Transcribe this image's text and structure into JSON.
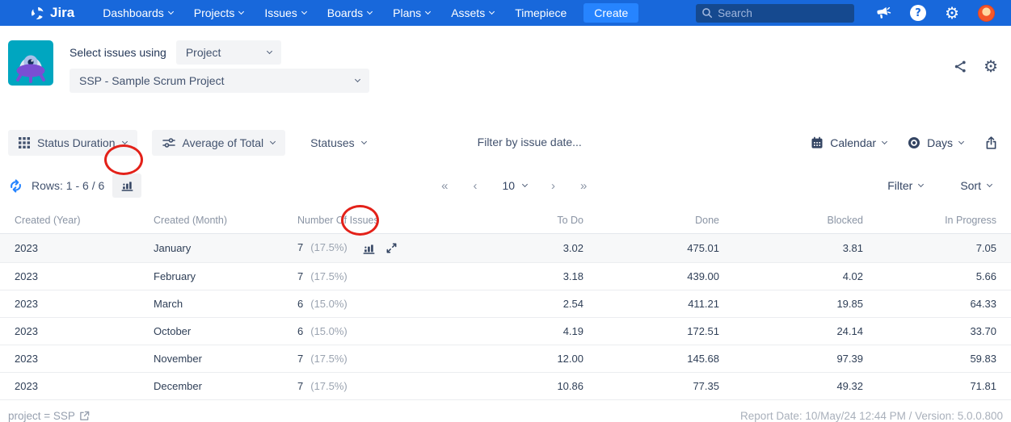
{
  "colors": {
    "nav_bg": "#1868db",
    "create_bg": "#2684ff",
    "search_bg": "#15498f",
    "accent_blue": "#2684ff",
    "annotation_red": "#e32119",
    "app_icon_teal": "#00a6c0",
    "app_icon_purple": "#7a4fd3",
    "row_highlight": "#f7f8f9"
  },
  "icons": {
    "gear_glyph": "⚙",
    "help_glyph": "?"
  },
  "nav": {
    "brand": "Jira",
    "items": [
      {
        "label": "Dashboards"
      },
      {
        "label": "Projects"
      },
      {
        "label": "Issues"
      },
      {
        "label": "Boards"
      },
      {
        "label": "Plans"
      },
      {
        "label": "Assets"
      },
      {
        "label": "Timepiece"
      }
    ],
    "create_label": "Create",
    "search_placeholder": "Search"
  },
  "header": {
    "select_label": "Select issues using",
    "issue_source": "Project",
    "project": "SSP - Sample Scrum Project"
  },
  "toolbar": {
    "report_type": "Status Duration",
    "aggregation": "Average of Total",
    "statuses_label": "Statuses",
    "date_filter_placeholder": "Filter by issue date...",
    "calendar_label": "Calendar",
    "unit_label": "Days"
  },
  "rows_bar": {
    "rows_label": "Rows: 1 - 6 / 6",
    "first": "«",
    "prev": "‹",
    "page_size": "10",
    "next": "›",
    "last": "»",
    "filter_label": "Filter",
    "sort_label": "Sort"
  },
  "table": {
    "columns": [
      "Created (Year)",
      "Created (Month)",
      "Number Of Issues",
      "To Do",
      "Done",
      "Blocked",
      "In Progress"
    ],
    "rows": [
      {
        "year": "2023",
        "month": "January",
        "issues": "7",
        "pct": "(17.5%)",
        "todo": "3.02",
        "done": "475.01",
        "blocked": "3.81",
        "inprogress": "7.05"
      },
      {
        "year": "2023",
        "month": "February",
        "issues": "7",
        "pct": "(17.5%)",
        "todo": "3.18",
        "done": "439.00",
        "blocked": "4.02",
        "inprogress": "5.66"
      },
      {
        "year": "2023",
        "month": "March",
        "issues": "6",
        "pct": "(15.0%)",
        "todo": "2.54",
        "done": "411.21",
        "blocked": "19.85",
        "inprogress": "64.33"
      },
      {
        "year": "2023",
        "month": "October",
        "issues": "6",
        "pct": "(15.0%)",
        "todo": "4.19",
        "done": "172.51",
        "blocked": "24.14",
        "inprogress": "33.70"
      },
      {
        "year": "2023",
        "month": "November",
        "issues": "7",
        "pct": "(17.5%)",
        "todo": "12.00",
        "done": "145.68",
        "blocked": "97.39",
        "inprogress": "59.83"
      },
      {
        "year": "2023",
        "month": "December",
        "issues": "7",
        "pct": "(17.5%)",
        "todo": "10.86",
        "done": "77.35",
        "blocked": "49.32",
        "inprogress": "71.81"
      }
    ]
  },
  "footer": {
    "query": "project = SSP",
    "report_info": "Report Date: 10/May/24 12:44 PM / Version: 5.0.0.800"
  }
}
